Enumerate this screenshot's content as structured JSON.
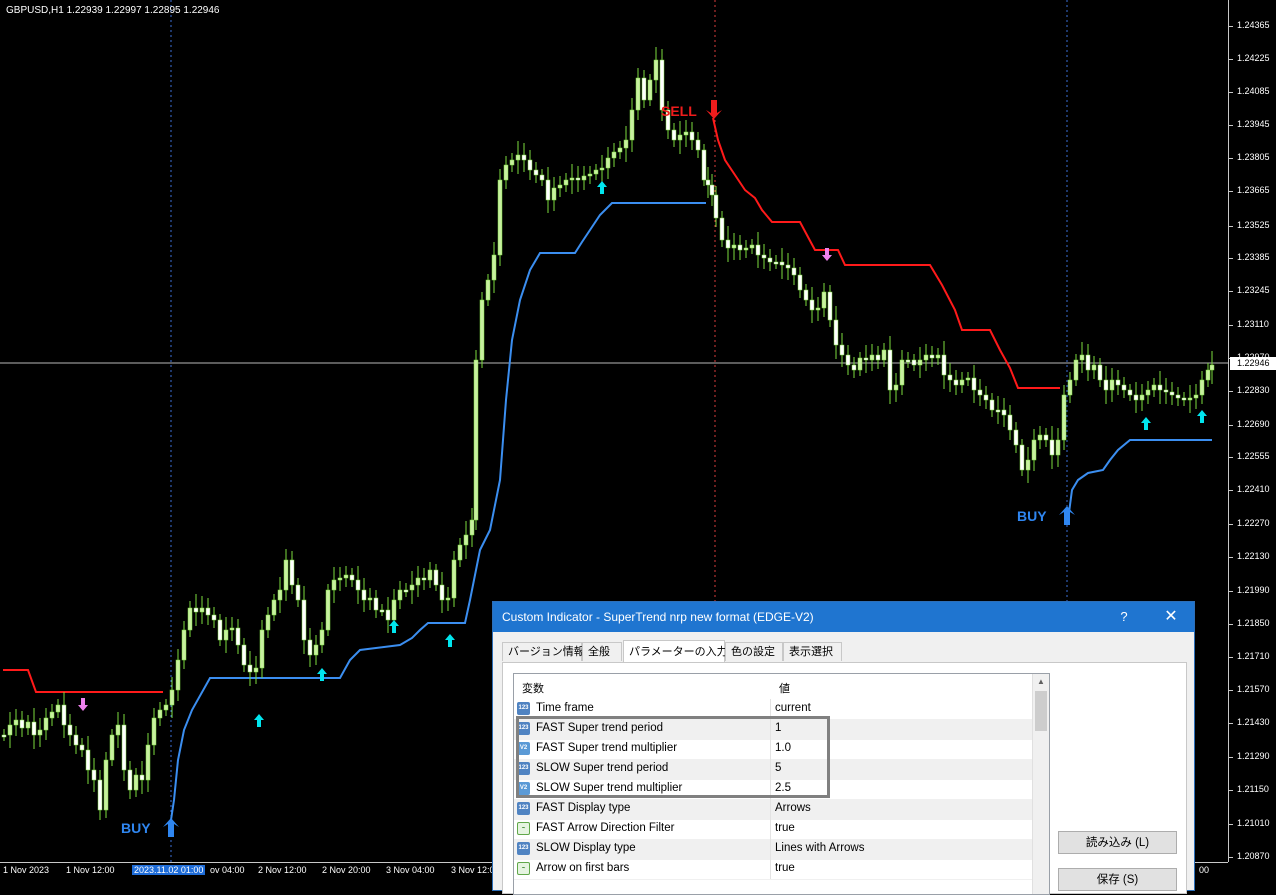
{
  "chart": {
    "symbol_info": "GBPUSD,H1  1.22939 1.22997 1.22895 1.22946",
    "current_price": "1.22946",
    "price_levels": [
      "1.24365",
      "1.24225",
      "1.24085",
      "1.23945",
      "1.23805",
      "1.23665",
      "1.23525",
      "1.23385",
      "1.23245",
      "1.23110",
      "1.22970",
      "1.22830",
      "1.22690",
      "1.22555",
      "1.22410",
      "1.22270",
      "1.22130",
      "1.21990",
      "1.21850",
      "1.21710",
      "1.21570",
      "1.21430",
      "1.21290",
      "1.21150",
      "1.21010",
      "1.20870"
    ],
    "time_labels": [
      {
        "text": "1 Nov 2023"
      },
      {
        "text": "1 Nov 12:00"
      },
      {
        "text": "2023.11.02 01:00",
        "highlight": true
      },
      {
        "text": "ov 04:00"
      },
      {
        "text": "2 Nov 12:00"
      },
      {
        "text": "2 Nov 20:00"
      },
      {
        "text": "3 Nov 04:00"
      },
      {
        "text": "3 Nov 12:00"
      },
      {
        "text": "00"
      }
    ],
    "annotations": {
      "buy_left": "BUY",
      "buy_right": "BUY",
      "sell": "SELL"
    },
    "colors": {
      "bull_candle": "#c8f0a0",
      "bear_candle": "#ffffff",
      "wick": "#7ddc3e",
      "supertrend_up": "#3b8ef0",
      "supertrend_down": "#ff1a1a",
      "arrow_fast_up": "#00e5ee",
      "arrow_fast_down": "#ee82ee",
      "buy_label": "#2f86f0",
      "sell_label": "#ee1c1c"
    }
  },
  "dialog": {
    "title": "Custom Indicator - SuperTrend nrp new format (EDGE-V2)",
    "help": "?",
    "close": "✕",
    "tabs": [
      "バージョン情報",
      "全般",
      "パラメーターの入力",
      "色の設定",
      "表示選択"
    ],
    "active_tab": "パラメーターの入力",
    "grid_header": {
      "name": "変数",
      "value": "値"
    },
    "params": [
      {
        "type": "int",
        "icon_text": "123",
        "name": "Time frame",
        "value": "current"
      },
      {
        "type": "int",
        "icon_text": "123",
        "name": "FAST Super trend period",
        "value": "1"
      },
      {
        "type": "dbl",
        "icon_text": "V2",
        "name": "FAST Super trend multiplier",
        "value": "1.0"
      },
      {
        "type": "int",
        "icon_text": "123",
        "name": "SLOW Super trend period",
        "value": "5"
      },
      {
        "type": "dbl",
        "icon_text": "V2",
        "name": "SLOW Super trend multiplier",
        "value": "2.5"
      },
      {
        "type": "int",
        "icon_text": "123",
        "name": "FAST Display type",
        "value": "Arrows"
      },
      {
        "type": "enum",
        "icon_text": "~",
        "name": "FAST Arrow Direction Filter",
        "value": "true"
      },
      {
        "type": "int",
        "icon_text": "123",
        "name": "SLOW Display type",
        "value": "Lines with Arrows"
      },
      {
        "type": "enum",
        "icon_text": "~",
        "name": "Arrow on first bars",
        "value": "true"
      }
    ],
    "buttons": {
      "load": "読み込み (L)",
      "save": "保存 (S)"
    }
  }
}
